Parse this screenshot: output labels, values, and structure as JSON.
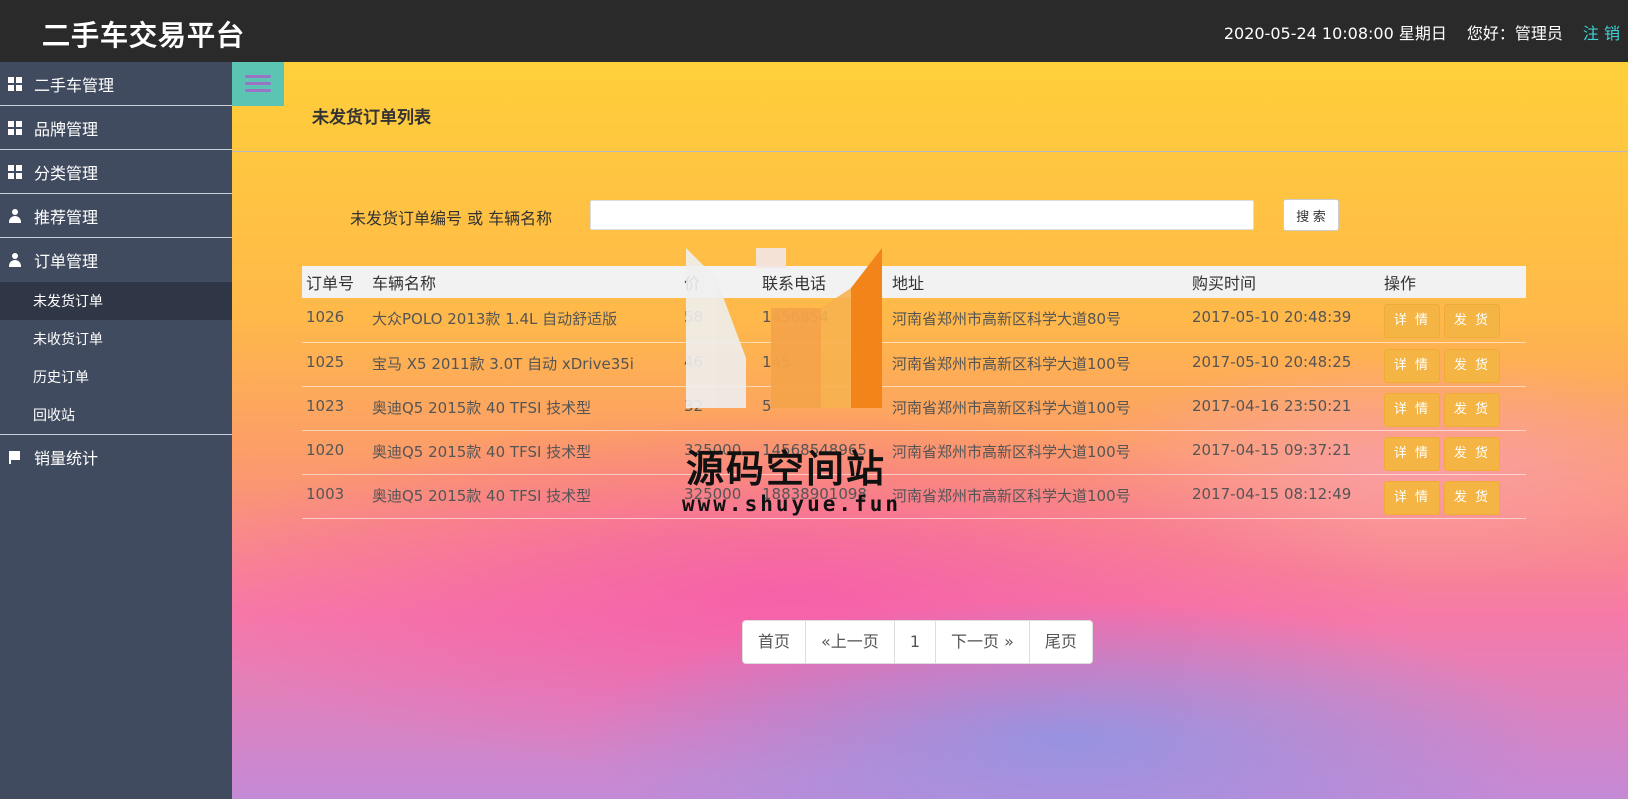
{
  "header": {
    "app_title": "二手车交易平台",
    "datetime": "2020-05-24 10:08:00 星期日",
    "greeting": "您好：管理员",
    "logout_label": "注 销"
  },
  "sidebar": {
    "items": [
      {
        "label": "二手车管理",
        "icon": "grid-icon"
      },
      {
        "label": "品牌管理",
        "icon": "grid-icon"
      },
      {
        "label": "分类管理",
        "icon": "grid-icon"
      },
      {
        "label": "推荐管理",
        "icon": "user-icon"
      },
      {
        "label": "订单管理",
        "icon": "user-icon"
      }
    ],
    "order_submenu": [
      "未发货订单",
      "未收货订单",
      "历史订单",
      "回收站"
    ],
    "active_submenu": "未发货订单",
    "stats_label": "销量统计",
    "stats_icon": "flag-icon"
  },
  "main": {
    "page_title": "未发货订单列表",
    "search": {
      "label": "未发货订单编号 或 车辆名称",
      "value": "",
      "button_label": "搜 索"
    },
    "table": {
      "columns": [
        "订单号",
        "车辆名称",
        "价",
        "联系电话",
        "地址",
        "购买时间",
        "操作"
      ],
      "rows": [
        {
          "id": "1026",
          "car": "大众POLO 2013款 1.4L 自动舒适版",
          "price": "58",
          "phone": "1456854",
          "address": "河南省郑州市高新区科学大道80号",
          "time": "2017-05-10 20:48:39"
        },
        {
          "id": "1025",
          "car": "宝马 X5 2011款 3.0T 自动 xDrive35i",
          "price": "46",
          "phone": "145",
          "address": "河南省郑州市高新区科学大道100号",
          "time": "2017-05-10 20:48:25"
        },
        {
          "id": "1023",
          "car": "奥迪Q5 2015款 40 TFSI 技术型",
          "price": "32",
          "phone": "5",
          "address": "河南省郑州市高新区科学大道100号",
          "time": "2017-04-16 23:50:21"
        },
        {
          "id": "1020",
          "car": "奥迪Q5 2015款 40 TFSI 技术型",
          "price": "325000",
          "phone": "14568548965",
          "address": "河南省郑州市高新区科学大道100号",
          "time": "2017-04-15 09:37:21"
        },
        {
          "id": "1003",
          "car": "奥迪Q5 2015款 40 TFSI 技术型",
          "price": "325000",
          "phone": "18838901098",
          "address": "河南省郑州市高新区科学大道100号",
          "time": "2017-04-15 08:12:49"
        }
      ],
      "detail_label": "详 情",
      "ship_label": "发 货"
    },
    "pagination": {
      "first": "首页",
      "prev": "«上一页",
      "current": "1",
      "next": "下一页 »",
      "last": "尾页"
    }
  },
  "watermark": {
    "text": "源码空间站",
    "url": "www.shuyue.fun"
  },
  "colors": {
    "topbar": "#2a2a2a",
    "sidebar": "#414b5f",
    "accent_logout": "#3fd1d4",
    "action_button": "#f4b544"
  }
}
